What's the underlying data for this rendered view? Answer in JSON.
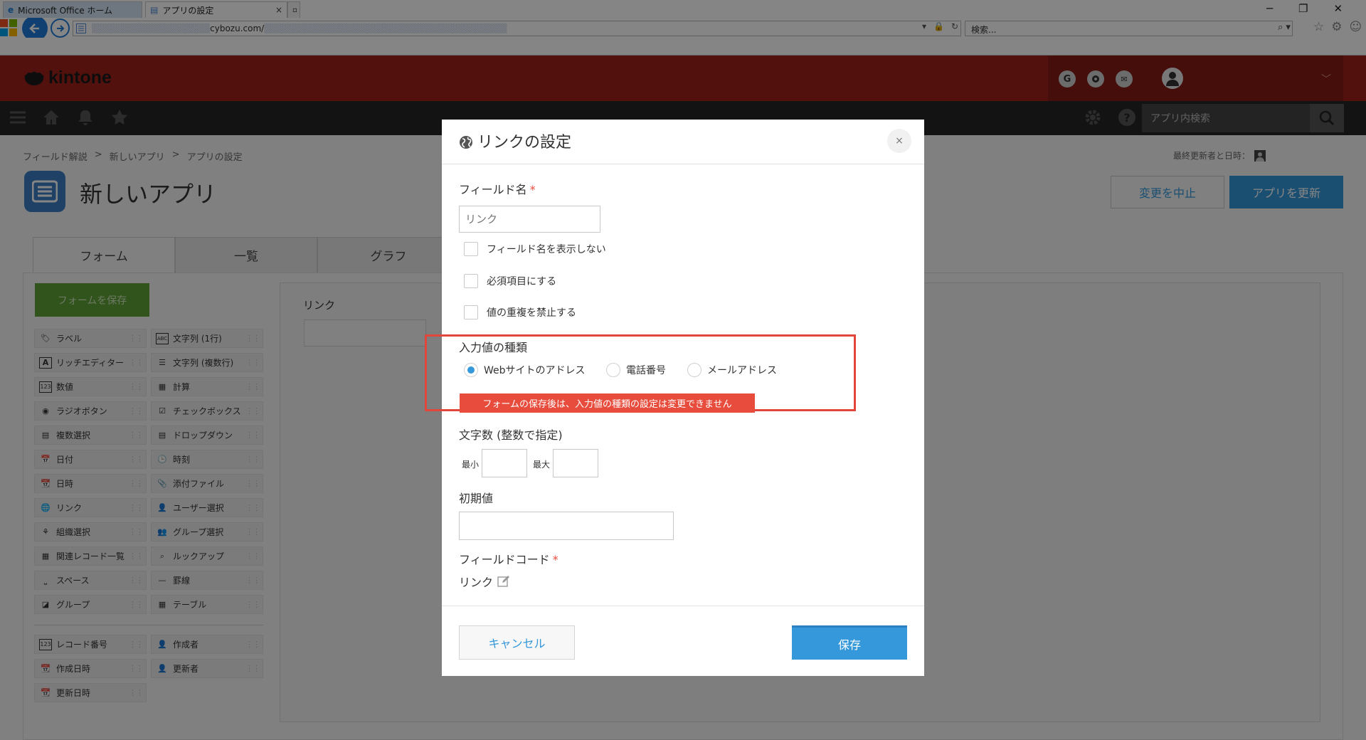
{
  "browser": {
    "url_host": "cybozu.com/",
    "search_placeholder": "検索...",
    "tabs": [
      {
        "label": "Microsoft Office ホーム"
      },
      {
        "label": "アプリの設定"
      }
    ]
  },
  "header": {
    "logo_text": "kintone",
    "circle_g": "G"
  },
  "nav": {
    "search_placeholder": "アプリ内検索"
  },
  "page": {
    "breadcrumb": [
      "フィールド解説",
      ">",
      "新しいアプリ",
      ">",
      "アプリの設定"
    ],
    "last_updated_label": "最終更新者と日時：",
    "app_title": "新しいアプリ",
    "cancel_changes_label": "変更を中止",
    "update_app_label": "アプリを更新",
    "tabs": [
      {
        "label": "フォーム"
      },
      {
        "label": "一覧"
      },
      {
        "label": "グラフ"
      }
    ],
    "save_form_label": "フォームを保存",
    "palette_left": [
      {
        "label": "ラベル",
        "icon": "tag-icon"
      },
      {
        "label": "リッチエディター",
        "icon": "rich-editor-icon"
      },
      {
        "label": "数値",
        "icon": "number-icon"
      },
      {
        "label": "ラジオボタン",
        "icon": "radio-icon"
      },
      {
        "label": "複数選択",
        "icon": "multi-select-icon"
      },
      {
        "label": "日付",
        "icon": "date-icon"
      },
      {
        "label": "日時",
        "icon": "datetime-icon"
      },
      {
        "label": "リンク",
        "icon": "globe-icon"
      },
      {
        "label": "組織選択",
        "icon": "org-icon"
      },
      {
        "label": "関連レコード一覧",
        "icon": "related-records-icon"
      },
      {
        "label": "スペース",
        "icon": "space-icon"
      },
      {
        "label": "グループ",
        "icon": "group-icon"
      }
    ],
    "palette_right": [
      {
        "label": "文字列 (1行)",
        "icon": "abc-icon"
      },
      {
        "label": "文字列 (複数行)",
        "icon": "multiline-icon"
      },
      {
        "label": "計算",
        "icon": "calc-icon"
      },
      {
        "label": "チェックボックス",
        "icon": "checkbox-icon"
      },
      {
        "label": "ドロップダウン",
        "icon": "dropdown-icon"
      },
      {
        "label": "時刻",
        "icon": "clock-icon"
      },
      {
        "label": "添付ファイル",
        "icon": "paperclip-icon"
      },
      {
        "label": "ユーザー選択",
        "icon": "user-icon"
      },
      {
        "label": "グループ選択",
        "icon": "users-icon"
      },
      {
        "label": "ルックアップ",
        "icon": "lookup-icon"
      },
      {
        "label": "罫線",
        "icon": "line-icon"
      },
      {
        "label": "テーブル",
        "icon": "table-icon"
      }
    ],
    "palette_system": [
      {
        "label": "レコード番号",
        "icon": "number-icon"
      },
      {
        "label": "作成者",
        "icon": "user-icon"
      },
      {
        "label": "作成日時",
        "icon": "datetime-icon"
      },
      {
        "label": "更新者",
        "icon": "user-icon"
      },
      {
        "label": "更新日時",
        "icon": "datetime-icon"
      }
    ],
    "canvas_field_label": "リンク"
  },
  "dialog": {
    "title": "リンクの設定",
    "field_name_label": "フィールド名",
    "required_mark": "*",
    "field_name_placeholder": "リンク",
    "checkboxes": [
      {
        "label": "フィールド名を表示しない",
        "checked": false
      },
      {
        "label": "必須項目にする",
        "checked": false
      },
      {
        "label": "値の重複を禁止する",
        "checked": false
      }
    ],
    "input_type_label": "入力値の種類",
    "input_types": [
      {
        "label": "Webサイトのアドレス",
        "selected": true
      },
      {
        "label": "電話番号",
        "selected": false
      },
      {
        "label": "メールアドレス",
        "selected": false
      }
    ],
    "input_type_warning": "フォームの保存後は、入力値の種類の設定は変更できません",
    "char_count_label": "文字数 (整数で指定)",
    "min_label": "最小",
    "max_label": "最大",
    "default_label": "初期値",
    "field_code_label": "フィールドコード",
    "field_code_value": "リンク",
    "cancel_label": "キャンセル",
    "save_label": "保存",
    "close_glyph": "×"
  },
  "colors": {
    "header_red": "#a0221c",
    "accent_blue": "#3498db",
    "save_green": "#5fa037",
    "warning_red": "#e74c3c"
  }
}
